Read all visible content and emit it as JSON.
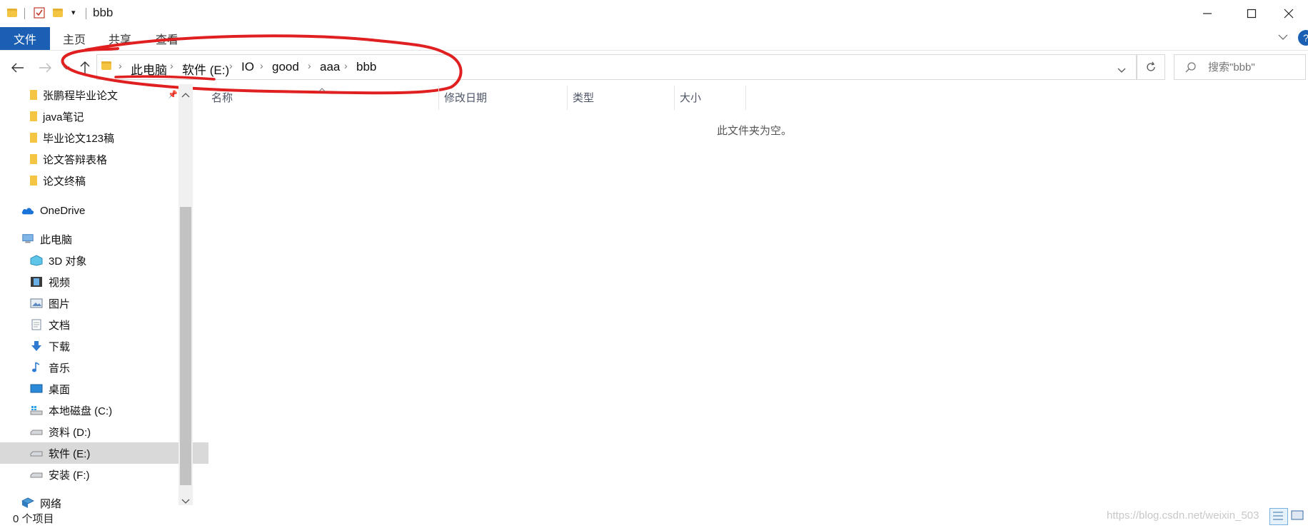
{
  "window": {
    "title": "bbb"
  },
  "ribbon": {
    "tabs": [
      "文件",
      "主页",
      "共享",
      "查看"
    ]
  },
  "address": {
    "crumbs": [
      "此电脑",
      "软件 (E:)",
      "IO",
      "good",
      "aaa",
      "bbb"
    ]
  },
  "search": {
    "placeholder": "搜索\"bbb\""
  },
  "sidebar": {
    "quick_access": [
      "张鹏程毕业论文",
      "java笔记",
      "毕业论文123稿",
      "论文答辩表格",
      "论文终稿"
    ],
    "onedrive": "OneDrive",
    "this_pc": "此电脑",
    "pc_items": [
      "3D 对象",
      "视频",
      "图片",
      "文档",
      "下载",
      "音乐",
      "桌面",
      "本地磁盘 (C:)",
      "资料 (D:)",
      "软件 (E:)",
      "安装 (F:)"
    ],
    "network": "网络",
    "selected": "软件 (E:)"
  },
  "columns": [
    "名称",
    "修改日期",
    "类型",
    "大小"
  ],
  "empty_message": "此文件夹为空。",
  "status": {
    "item_count": "0 个项目"
  },
  "watermark": "https://blog.csdn.net/weixin_503",
  "colors": {
    "accent": "#1a5fb4",
    "annotation": "#e02020",
    "folder": "#f4c542"
  }
}
